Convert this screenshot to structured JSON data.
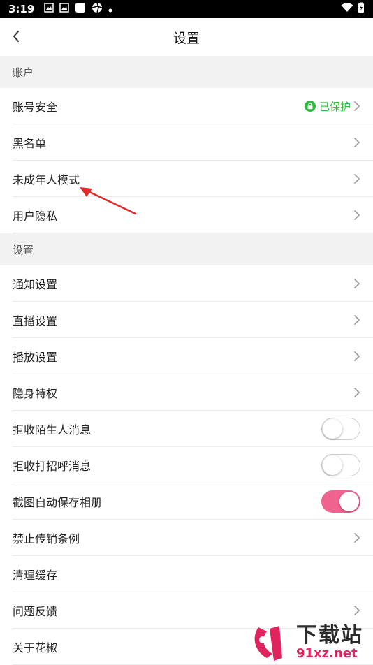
{
  "status_bar": {
    "time": "3:19"
  },
  "nav": {
    "title": "设置"
  },
  "sections": [
    {
      "header": "账户",
      "rows": [
        {
          "label": "账号安全",
          "status": "已保护",
          "accessory": "chevron"
        },
        {
          "label": "黑名单",
          "accessory": "chevron"
        },
        {
          "label": "未成年人模式",
          "accessory": "chevron"
        },
        {
          "label": "用户隐私",
          "accessory": "chevron"
        }
      ]
    },
    {
      "header": "设置",
      "rows": [
        {
          "label": "通知设置",
          "accessory": "chevron"
        },
        {
          "label": "直播设置",
          "accessory": "chevron"
        },
        {
          "label": "播放设置",
          "accessory": "chevron"
        },
        {
          "label": "隐身特权",
          "accessory": "chevron"
        },
        {
          "label": "拒收陌生人消息",
          "accessory": "toggle",
          "toggle_on": false
        },
        {
          "label": "拒收打招呼消息",
          "accessory": "toggle",
          "toggle_on": false
        },
        {
          "label": "截图自动保存相册",
          "accessory": "toggle",
          "toggle_on": true
        },
        {
          "label": "禁止传销条例",
          "accessory": "chevron"
        },
        {
          "label": "清理缓存",
          "accessory": "none"
        },
        {
          "label": "问题反馈",
          "accessory": "chevron"
        },
        {
          "label": "关于花椒",
          "accessory": "none"
        }
      ]
    }
  ],
  "colors": {
    "accent_pink": "#f0638e",
    "protect_green": "#2dbd3c",
    "section_bg": "#f2f2f2",
    "annotation_red": "#e02a2a"
  },
  "watermark": {
    "cn": "下载站",
    "url": "91xz.net"
  }
}
